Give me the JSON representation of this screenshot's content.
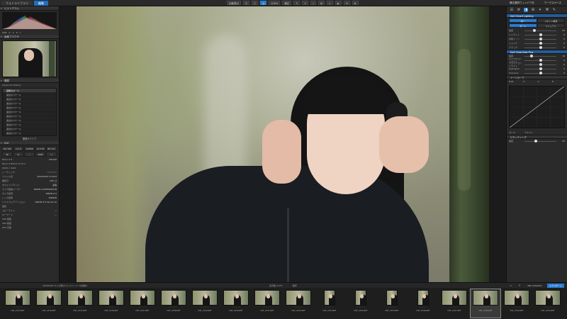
{
  "topbar": {
    "tabs": [
      "フォトライブラリ",
      "編集"
    ],
    "tools": [
      "比較表示",
      "⊡",
      "□",
      "◎",
      "100%",
      "補正",
      "✎",
      "✐",
      "⌖",
      "⧉",
      "✂",
      "◐",
      "⟲",
      "⊕"
    ],
    "right_buttons": [
      "構文選択ウィンドウを",
      "ワークスペース"
    ]
  },
  "left": {
    "histogram_title": "ヒストグラム",
    "histogram_row": [
      "RGB",
      "R",
      "G",
      "B",
      "L"
    ],
    "navigator_title": "画像ブラウザ",
    "history_title": "履歴",
    "history_subtitle": "Advanced History",
    "history_items": [
      "画像のロード",
      "露出のスケール",
      "露出のスケール",
      "露出のスケール",
      "露出のスケール",
      "露出のスケール",
      "露出のスケール",
      "露出のスケール",
      "露出のスケール",
      "露出のスケール",
      "露出のスケール"
    ],
    "history_clear": "履歴のクリア",
    "exif_title": "Exif",
    "exif_cells": [
      "ISO 100",
      "1/1.6",
      "1/2000 s",
      "+0.3 EV",
      "85 mm",
      "⊠",
      "⊡",
      "—",
      "RAW",
      "○"
    ],
    "info": [
      {
        "k": "Nikon Z 6",
        "v": "ISO100"
      },
      {
        "k": "Nikon Z 85mm f/1.8 S",
        "v": ""
      },
      {
        "k": "6048 × 4024",
        "v": ""
      },
      {
        "k": "レーティング",
        "v": "☆☆☆☆☆"
      },
      {
        "k": "ファイル名",
        "v": "20240228 171433"
      },
      {
        "k": "撮影日",
        "v": "DSC_0"
      },
      {
        "k": "ホワイトバランス",
        "v": "太陽"
      },
      {
        "k": "カメラ製造メーカー",
        "v": "NIKON CORPORATION"
      },
      {
        "k": "カメラ名称",
        "v": "NIKON Z 6"
      },
      {
        "k": "レンズ名称",
        "v": "NIKKOR"
      },
      {
        "k": "ソフトウェアバージョン",
        "v": "NIKON Z 6 Ver.03.10"
      },
      {
        "k": "画質",
        "v": ""
      },
      {
        "k": "コピーライト",
        "v": "—"
      },
      {
        "k": "キーワード",
        "v": "—"
      },
      {
        "k": "GPS 緯度",
        "v": ""
      },
      {
        "k": "GPS 経度",
        "v": ""
      },
      {
        "k": "GPS 高度",
        "v": ""
      }
    ]
  },
  "right": {
    "tool_icons": [
      "☰",
      "⚙",
      "◑",
      "⊞",
      "✦",
      "⌘",
      "✎"
    ],
    "sections": {
      "s1": "DxO Smart Lighting",
      "s2": "DxO ClearView Plus",
      "s3": "トーンカーブ",
      "s4": "ビネッティング"
    },
    "seg1": [
      "均一",
      "スポット重視"
    ],
    "seg2": [
      "オート",
      "マニュアル"
    ],
    "sliders1": [
      {
        "label": "強度",
        "value": "25",
        "pos": 0.3
      }
    ],
    "sliders2": [
      {
        "label": "ハイライト",
        "value": "0",
        "pos": 0.5
      },
      {
        "label": "中間トーン",
        "value": "0",
        "pos": 0.5
      },
      {
        "label": "シャドウ",
        "value": "0",
        "pos": 0.5
      },
      {
        "label": "ブラック",
        "value": "0",
        "pos": 0.5
      }
    ],
    "sliders3": [
      {
        "label": "強度",
        "value": "10",
        "pos": 0.2
      },
      {
        "label": "マイクロコントラスト",
        "value": "0",
        "pos": 0.5
      },
      {
        "label": "ファインコントラスト",
        "value": "0",
        "pos": 0.5
      },
      {
        "label": "Highlights",
        "value": "0",
        "pos": 0.5
      },
      {
        "label": "Shadows",
        "value": "0",
        "pos": 0.5
      }
    ],
    "curve_tabs": [
      "RGB",
      "R",
      "G",
      "B"
    ],
    "curve_labels": {
      "gamma": "ガンマ",
      "text": "テキスト"
    },
    "bottom_row": {
      "label": "強度",
      "value": "25"
    }
  },
  "filmbar": {
    "path": "20240228 クリエ再びハイドゥートーの感想2",
    "count": "表示数 17/37",
    "selected": "選択",
    "right": [
      "▽",
      "☷",
      "Nik Collection",
      "エクスポート"
    ]
  },
  "filmstrip": [
    {
      "name": "DSF_2333.NEF",
      "port": false
    },
    {
      "name": "DSF_2334.NEF",
      "port": false
    },
    {
      "name": "DSF_2335.NEF",
      "port": false
    },
    {
      "name": "DSF_2336.NEF",
      "port": false
    },
    {
      "name": "DSF_2337.NEF",
      "port": false
    },
    {
      "name": "DSF_2338.NEF",
      "port": false
    },
    {
      "name": "DSF_2339.NEF",
      "port": false
    },
    {
      "name": "DSF_2340.NEF",
      "port": false
    },
    {
      "name": "DSF_2341.NEF",
      "port": false
    },
    {
      "name": "DSF_2342.NEF",
      "port": false
    },
    {
      "name": "DSF_2343.NEF",
      "port": true
    },
    {
      "name": "DSF_2344.NEF",
      "port": true
    },
    {
      "name": "DSF_2345.NEF",
      "port": true
    },
    {
      "name": "DSF_2346.NEF",
      "port": true
    },
    {
      "name": "DSF_2347.NEF",
      "port": false
    },
    {
      "name": "DSF_2348.NEF",
      "port": false
    },
    {
      "name": "DSF_2349.NEF",
      "port": false
    },
    {
      "name": "DSF_2350.NEF",
      "port": false
    }
  ],
  "selected_frame": 15,
  "rating": "☆☆☆☆☆"
}
